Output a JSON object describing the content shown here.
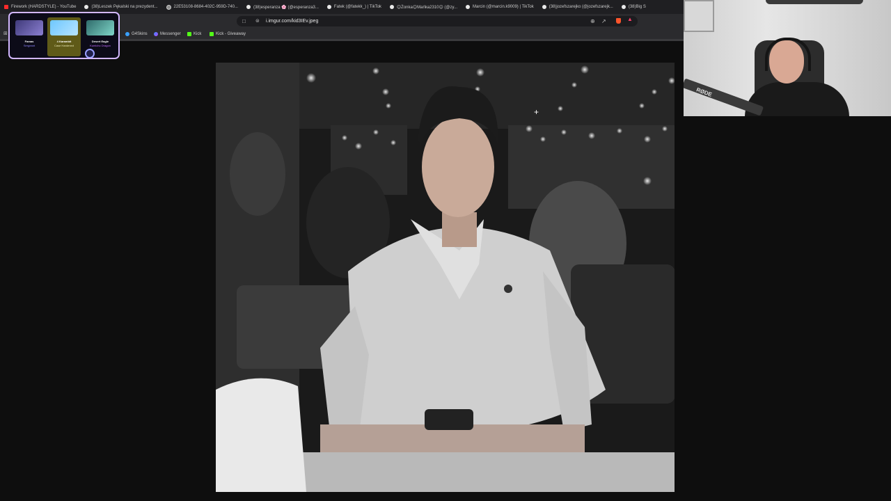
{
  "browser": {
    "tabs": [
      {
        "label": "Firework (HARDSTYLE) - YouTube",
        "icon": "youtube-icon"
      },
      {
        "label": "(38)Leszek Pękalski na prezydent...",
        "icon": "tiktok-icon"
      },
      {
        "label": "22E53108-8684-402C-959D-740...",
        "icon": "globe-icon"
      },
      {
        "label": "(38)esperanza 🌸 (@esperanza3...",
        "icon": "tiktok-icon"
      },
      {
        "label": "Fatek (@fatekk_) | TikTok",
        "icon": "tiktok-icon"
      },
      {
        "label": "😊Żonka😊Mańka2310😊 (@zy...",
        "icon": "tiktok-icon"
      },
      {
        "label": "Marcin (@marcin.k9009) | TikTok",
        "icon": "tiktok-icon"
      },
      {
        "label": "(38)jozefszarejko (@jozefszarejk...",
        "icon": "tiktok-icon"
      },
      {
        "label": "(38)Big S",
        "icon": "tiktok-icon"
      }
    ],
    "address": {
      "url": "i.imgur.com/kid3IEv.jpeg"
    },
    "bookmarks": [
      {
        "label": "G4Skins",
        "icon": "g4skins-icon"
      },
      {
        "label": "Messenger",
        "icon": "messenger-icon"
      },
      {
        "label": "Kick",
        "icon": "kick-icon"
      },
      {
        "label": "Kick - Giveaway",
        "icon": "kick-icon"
      }
    ]
  },
  "overlay": {
    "cases": [
      {
        "name": "Famas",
        "sub": "Sergeant"
      },
      {
        "name": "4 Karambit",
        "sub": "Case Hardened"
      },
      {
        "name": "Desert Eagle",
        "sub": "Kumicho Dragon"
      }
    ]
  },
  "webcam": {
    "mic_brand": "RØDE"
  },
  "colors": {
    "accent": "#d2b7ff",
    "youtube": "#ff2b2b",
    "kick": "#53fc18"
  }
}
